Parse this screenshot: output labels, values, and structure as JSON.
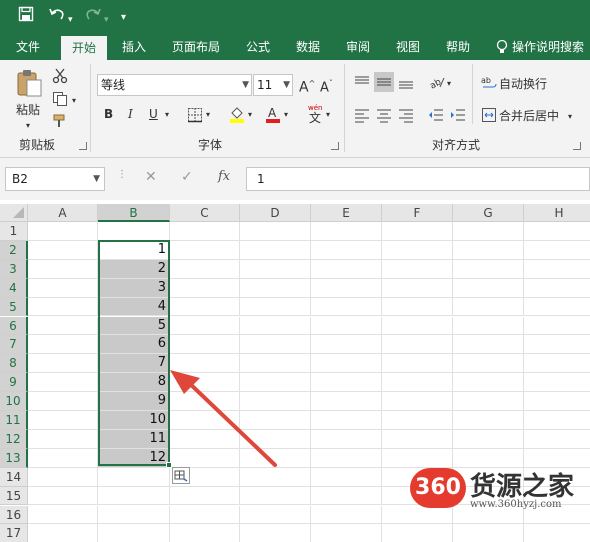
{
  "quick_access": {
    "save_icon": "save-icon",
    "undo_icon": "undo-icon",
    "redo_icon": "redo-icon",
    "customize": "▾"
  },
  "tabs": [
    "文件",
    "开始",
    "插入",
    "页面布局",
    "公式",
    "数据",
    "审阅",
    "视图",
    "帮助"
  ],
  "active_tab": "开始",
  "tell_me": "操作说明搜索",
  "ribbon": {
    "clipboard": {
      "paste": "粘贴",
      "label": "剪贴板"
    },
    "font": {
      "name": "等线",
      "size": "11",
      "bold": "B",
      "italic": "I",
      "underline": "U",
      "label": "字体"
    },
    "alignment": {
      "wrap": "自动换行",
      "merge": "合并后居中",
      "label": "对齐方式"
    }
  },
  "formula_bar": {
    "name_box": "B2",
    "fx": "fx",
    "value": "1"
  },
  "columns": [
    "A",
    "B",
    "C",
    "D",
    "E",
    "F",
    "G",
    "H"
  ],
  "rows": [
    "1",
    "2",
    "3",
    "4",
    "5",
    "6",
    "7",
    "8",
    "9",
    "10",
    "11",
    "12",
    "13",
    "14",
    "15",
    "16",
    "17"
  ],
  "column_b_values": [
    "",
    "1",
    "2",
    "3",
    "4",
    "5",
    "6",
    "7",
    "8",
    "9",
    "10",
    "11",
    "12",
    "",
    "",
    "",
    ""
  ],
  "colors": {
    "accent": "#217346",
    "selection_fill": "#c9c9c9",
    "arrow": "#e0473b"
  },
  "watermark": {
    "logo": "360",
    "name": "货源之家",
    "url": "www.360hyzj.com"
  }
}
